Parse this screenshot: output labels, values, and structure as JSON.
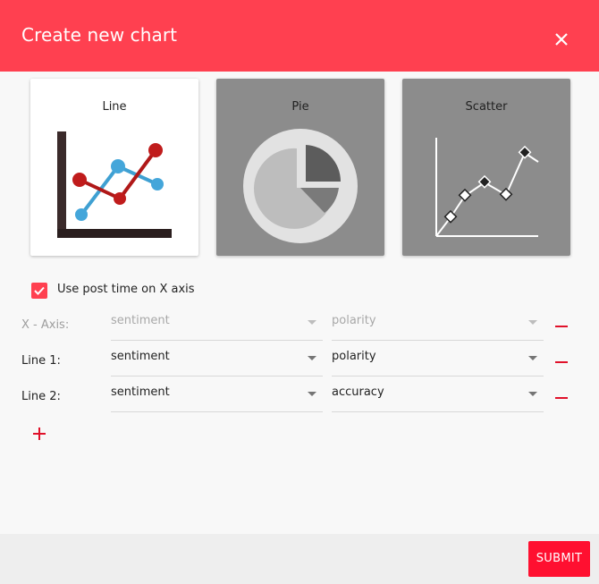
{
  "dialog": {
    "title": "Create new chart"
  },
  "chart_types": [
    {
      "label": "Line",
      "selected": true,
      "icon": "line-chart-icon"
    },
    {
      "label": "Pie",
      "selected": false,
      "icon": "pie-chart-icon"
    },
    {
      "label": "Scatter",
      "selected": false,
      "icon": "scatter-chart-icon"
    }
  ],
  "options": {
    "use_post_time_label": "Use post time on X axis",
    "use_post_time_checked": true
  },
  "axes": {
    "x_axis": {
      "label": "X - Axis:",
      "field": "sentiment",
      "metric": "polarity",
      "disabled": true
    },
    "lines": [
      {
        "label": "Line 1:",
        "field": "sentiment",
        "metric": "polarity"
      },
      {
        "label": "Line 2:",
        "field": "sentiment",
        "metric": "accuracy"
      }
    ]
  },
  "footer": {
    "submit_label": "SUBMIT"
  },
  "colors": {
    "header": "#ff4050",
    "accent": "#e0112a",
    "submit": "#ff1030",
    "card_unselected": "#8c8c8c"
  }
}
